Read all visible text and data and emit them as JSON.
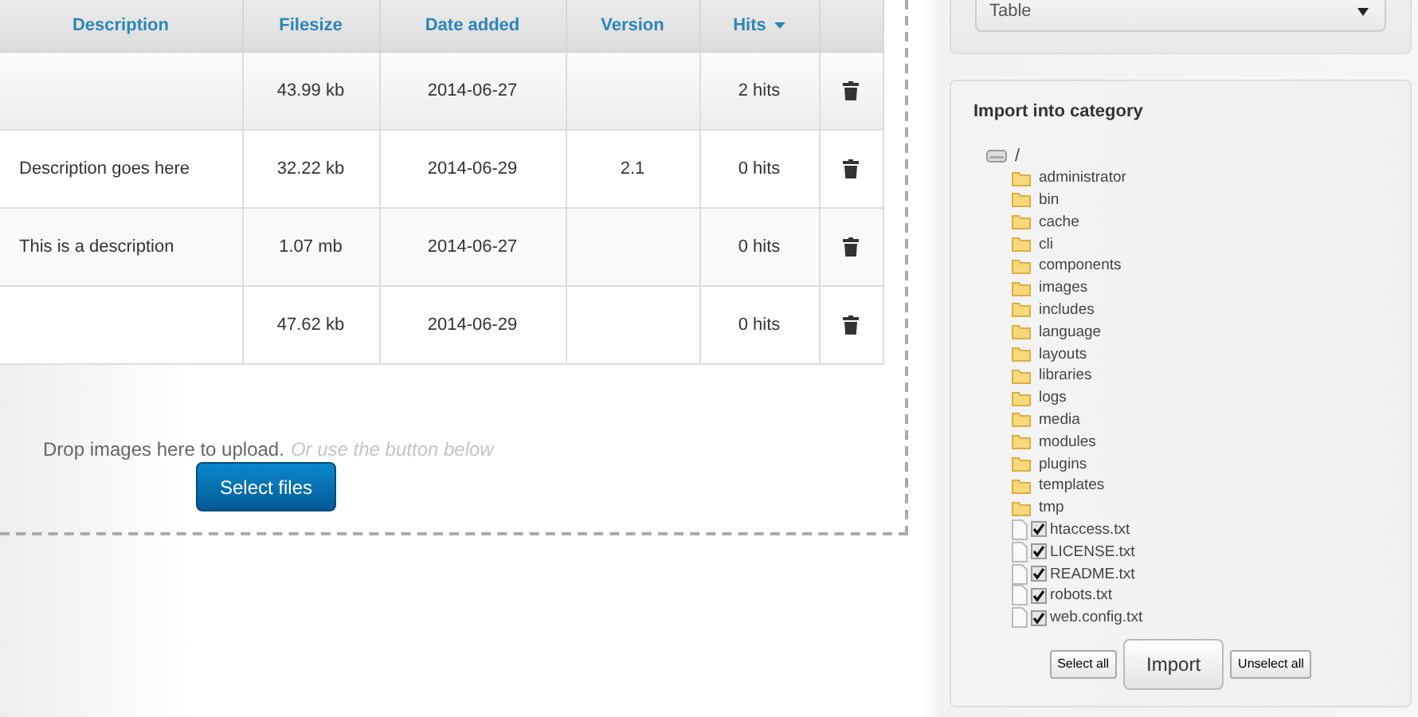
{
  "table": {
    "columns": [
      {
        "label": "Description",
        "sorted": false
      },
      {
        "label": "Filesize",
        "sorted": false
      },
      {
        "label": "Date added",
        "sorted": false
      },
      {
        "label": "Version",
        "sorted": false
      },
      {
        "label": "Hits",
        "sorted": true
      }
    ],
    "rows": [
      {
        "description": "",
        "filesize": "43.99 kb",
        "date": "2014-06-27",
        "version": "",
        "hits": "2 hits"
      },
      {
        "description": "Description goes here",
        "filesize": "32.22 kb",
        "date": "2014-06-29",
        "version": "2.1",
        "hits": "0 hits"
      },
      {
        "description": "This is a description",
        "filesize": "1.07 mb",
        "date": "2014-06-27",
        "version": "",
        "hits": "0 hits"
      },
      {
        "description": "",
        "filesize": "47.62 kb",
        "date": "2014-06-29",
        "version": "",
        "hits": "0 hits"
      }
    ]
  },
  "upload": {
    "text": "Drop images here to upload.",
    "hint": "Or use the button below",
    "button": "Select files"
  },
  "layout_select": {
    "value": "Table"
  },
  "import": {
    "title": "Import into category",
    "tree": {
      "label": "/",
      "children": [
        {
          "kind": "folder",
          "label": "administrator"
        },
        {
          "kind": "folder",
          "label": "bin"
        },
        {
          "kind": "folder",
          "label": "cache"
        },
        {
          "kind": "folder",
          "label": "cli"
        },
        {
          "kind": "folder",
          "label": "components"
        },
        {
          "kind": "folder",
          "label": "images"
        },
        {
          "kind": "folder",
          "label": "includes"
        },
        {
          "kind": "folder",
          "label": "language"
        },
        {
          "kind": "folder",
          "label": "layouts"
        },
        {
          "kind": "folder",
          "label": "libraries"
        },
        {
          "kind": "folder",
          "label": "logs"
        },
        {
          "kind": "folder",
          "label": "media"
        },
        {
          "kind": "folder",
          "label": "modules"
        },
        {
          "kind": "folder",
          "label": "plugins"
        },
        {
          "kind": "folder",
          "label": "templates"
        },
        {
          "kind": "folder",
          "label": "tmp"
        },
        {
          "kind": "file",
          "label": "htaccess.txt",
          "checked": true
        },
        {
          "kind": "file",
          "label": "LICENSE.txt",
          "checked": true
        },
        {
          "kind": "file",
          "label": "README.txt",
          "checked": true
        },
        {
          "kind": "file",
          "label": "robots.txt",
          "checked": true
        },
        {
          "kind": "file",
          "label": "web.config.txt",
          "checked": true
        }
      ]
    },
    "buttons": {
      "select_all": "Select all",
      "import": "Import",
      "unselect_all": "Unselect all"
    }
  }
}
